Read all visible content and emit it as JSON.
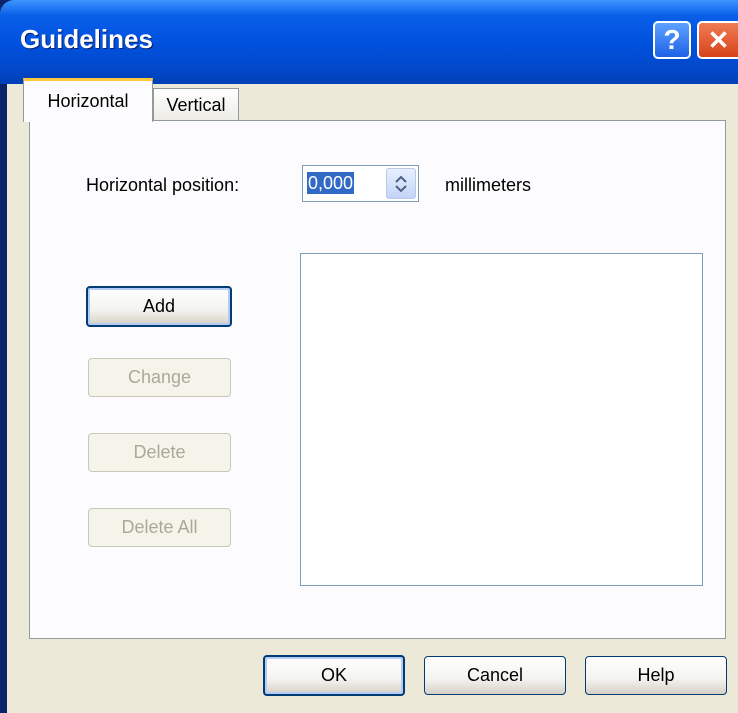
{
  "window": {
    "title": "Guidelines",
    "help_glyph": "?",
    "close_glyph": "✕"
  },
  "tabs": [
    {
      "label": "Horizontal",
      "active": true
    },
    {
      "label": "Vertical",
      "active": false
    }
  ],
  "position": {
    "label": "Horizontal position:",
    "value": "0,000",
    "unit": "millimeters"
  },
  "side_buttons": {
    "add": "Add",
    "change": "Change",
    "delete": "Delete",
    "delete_all": "Delete All"
  },
  "footer_buttons": {
    "ok": "OK",
    "cancel": "Cancel",
    "help": "Help"
  },
  "guidelines_list": [],
  "colors": {
    "titlebar": "#0052e0",
    "selection": "#316ac5",
    "active_tab_accent": "#ffc83c",
    "disabled_text": "#aca899"
  },
  "icons": {
    "help": "question-icon",
    "close": "close-icon",
    "spin_up": "chevron-up-icon",
    "spin_down": "chevron-down-icon"
  }
}
